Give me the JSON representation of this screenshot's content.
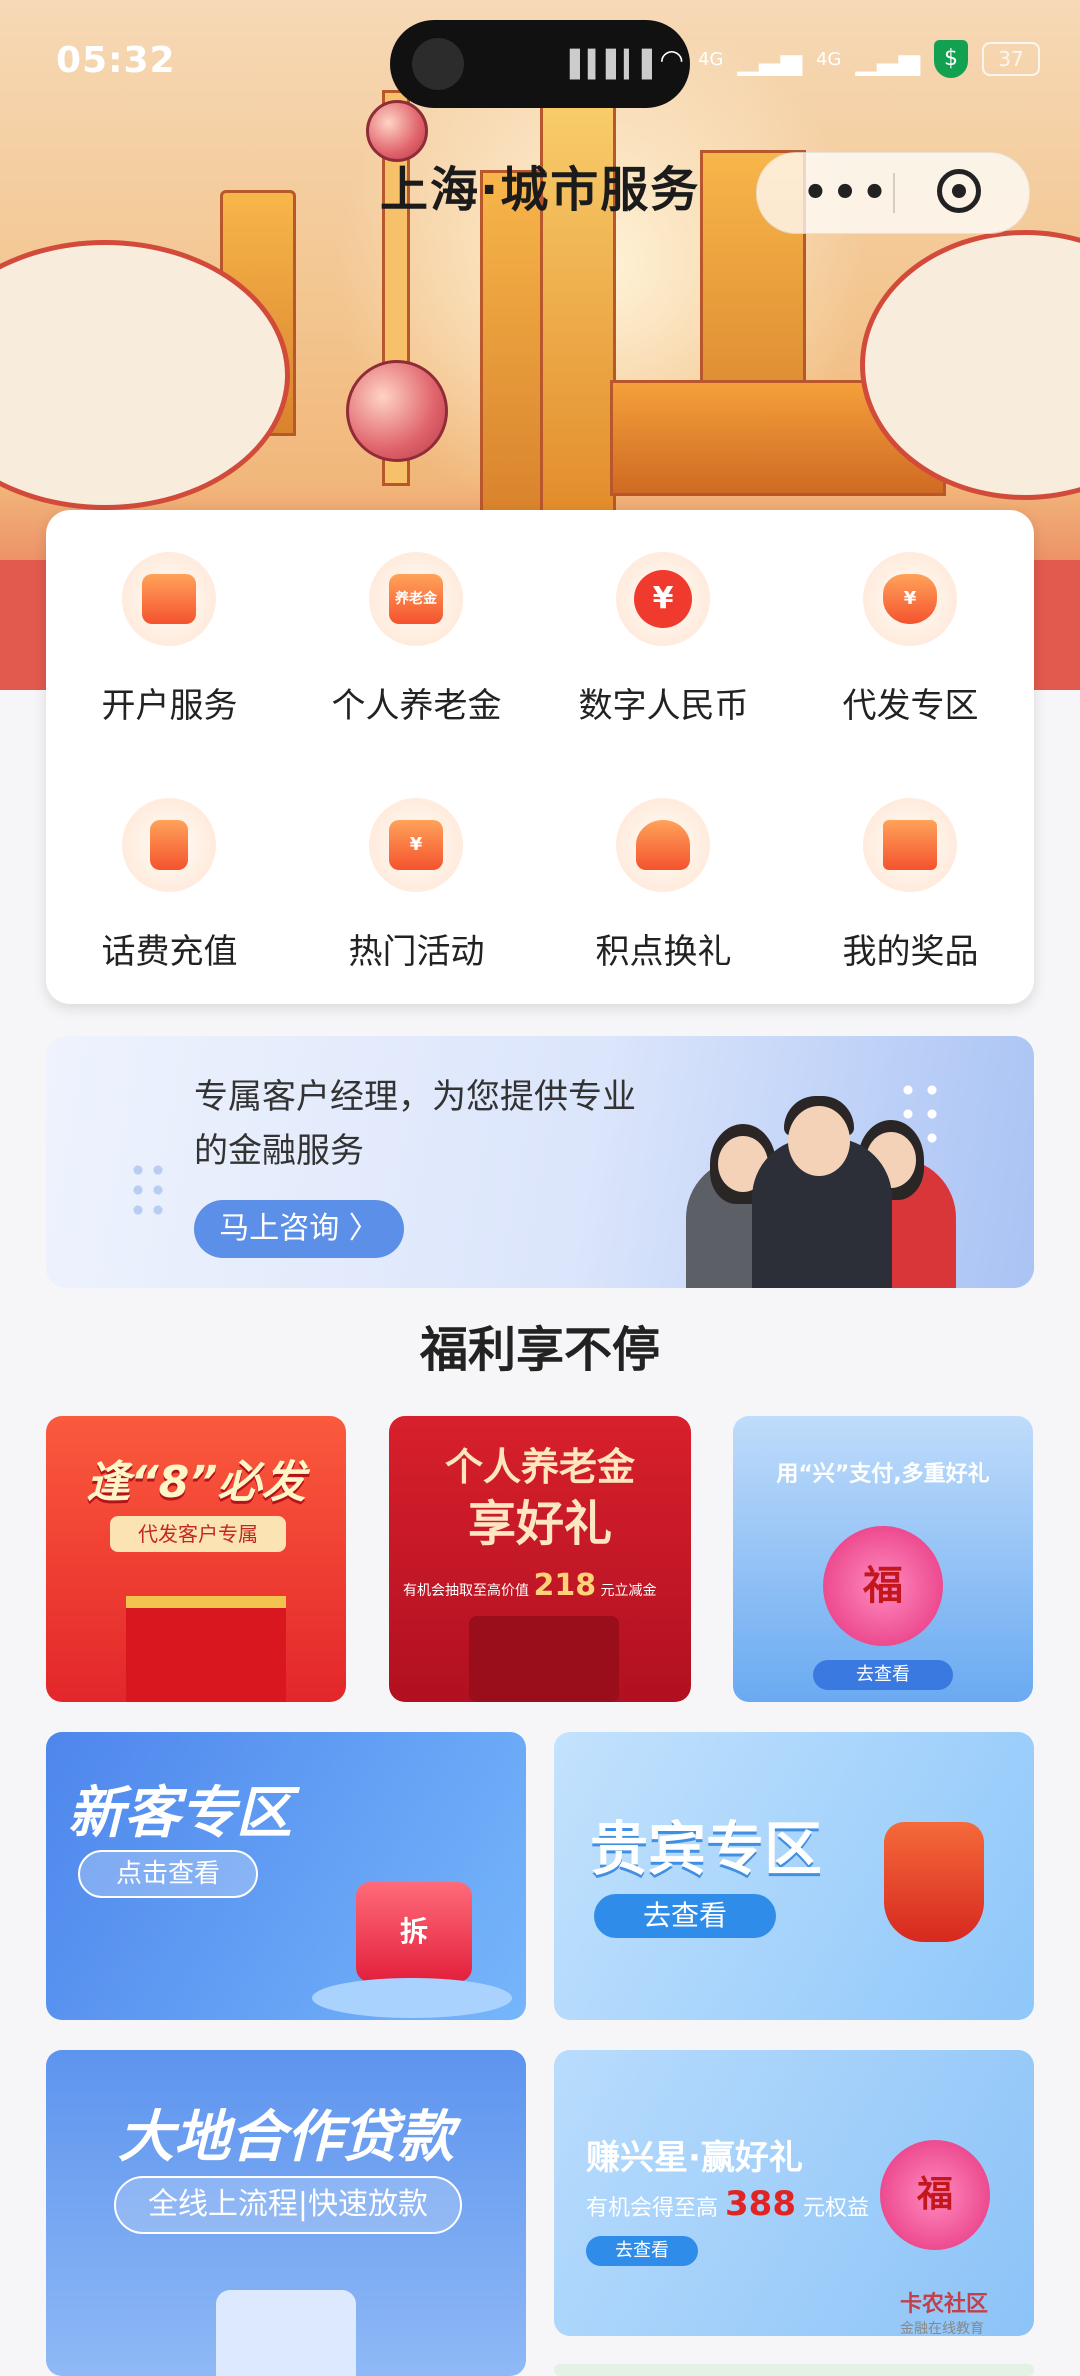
{
  "status_bar": {
    "time": "05:32",
    "signal1": "4G",
    "signal2": "4G",
    "battery": "37"
  },
  "header": {
    "title": "上海·城市服务",
    "menu_dots": "•••"
  },
  "services": [
    {
      "label": "开户服务",
      "icon": "card-icon",
      "glyph": ""
    },
    {
      "label": "个人养老金",
      "icon": "pension-icon",
      "glyph": "养老金"
    },
    {
      "label": "数字人民币",
      "icon": "digital-rmb-icon",
      "glyph": "¥"
    },
    {
      "label": "代发专区",
      "icon": "money-bag-icon",
      "glyph": "¥"
    },
    {
      "label": "话费充值",
      "icon": "phone-icon",
      "glyph": ""
    },
    {
      "label": "热门活动",
      "icon": "gift-card-icon",
      "glyph": "¥"
    },
    {
      "label": "积点换礼",
      "icon": "rocking-horse-icon",
      "glyph": ""
    },
    {
      "label": "我的奖品",
      "icon": "gift-icon",
      "glyph": ""
    }
  ],
  "consult": {
    "text_line1": "专属客户经理，为您提供专业",
    "text_line2": "的金融服务",
    "button": "马上咨询 〉"
  },
  "section_title": "福利享不停",
  "promos": {
    "p1": {
      "title": "逢“8”必发",
      "sub": "代发客户专属"
    },
    "p2": {
      "title1": "个人养老金",
      "title2": "享好礼",
      "sub_pre": "有机会抽取至高价值",
      "amount": "218",
      "sub_post": "元立减金"
    },
    "p3": {
      "title": "用“兴”支付,多重好礼",
      "bag": "福",
      "button": "去查看"
    },
    "p4": {
      "title": "新客专区",
      "button": "点击查看",
      "badge": "拆"
    },
    "p5": {
      "title": "贵宾专区",
      "button": "去查看"
    },
    "p6": {
      "title": "大地合作贷款",
      "sub": "全线上流程|快速放款"
    },
    "p7": {
      "title": "赚兴星·赢好礼",
      "sub_pre": "有机会得至高",
      "amount": "388",
      "sub_post": "元权益",
      "button": "去查看",
      "bag": "福"
    }
  },
  "watermark": {
    "name": "卡农社区",
    "sub": "金融在线教育"
  }
}
